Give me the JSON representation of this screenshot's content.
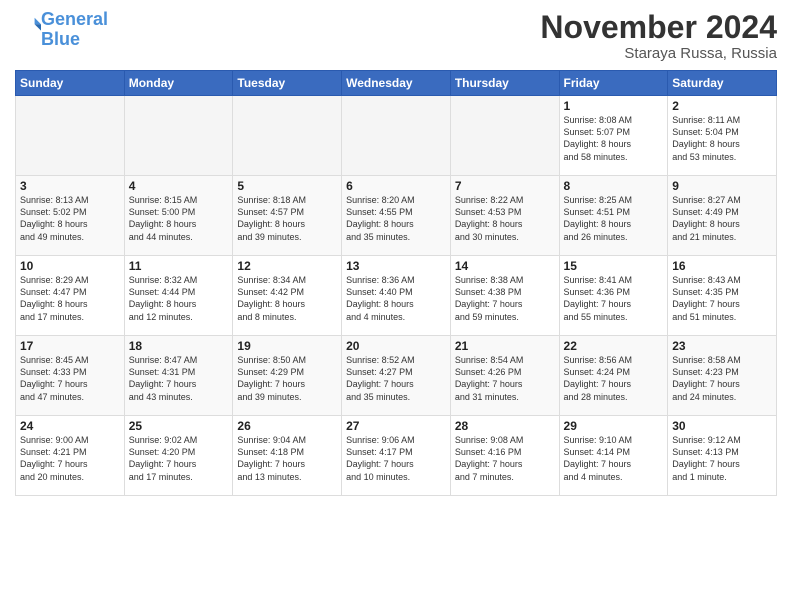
{
  "header": {
    "logo_line1": "General",
    "logo_line2": "Blue",
    "month_title": "November 2024",
    "location": "Staraya Russa, Russia"
  },
  "days_of_week": [
    "Sunday",
    "Monday",
    "Tuesday",
    "Wednesday",
    "Thursday",
    "Friday",
    "Saturday"
  ],
  "weeks": [
    [
      {
        "day": "",
        "info": ""
      },
      {
        "day": "",
        "info": ""
      },
      {
        "day": "",
        "info": ""
      },
      {
        "day": "",
        "info": ""
      },
      {
        "day": "",
        "info": ""
      },
      {
        "day": "1",
        "info": "Sunrise: 8:08 AM\nSunset: 5:07 PM\nDaylight: 8 hours\nand 58 minutes."
      },
      {
        "day": "2",
        "info": "Sunrise: 8:11 AM\nSunset: 5:04 PM\nDaylight: 8 hours\nand 53 minutes."
      }
    ],
    [
      {
        "day": "3",
        "info": "Sunrise: 8:13 AM\nSunset: 5:02 PM\nDaylight: 8 hours\nand 49 minutes."
      },
      {
        "day": "4",
        "info": "Sunrise: 8:15 AM\nSunset: 5:00 PM\nDaylight: 8 hours\nand 44 minutes."
      },
      {
        "day": "5",
        "info": "Sunrise: 8:18 AM\nSunset: 4:57 PM\nDaylight: 8 hours\nand 39 minutes."
      },
      {
        "day": "6",
        "info": "Sunrise: 8:20 AM\nSunset: 4:55 PM\nDaylight: 8 hours\nand 35 minutes."
      },
      {
        "day": "7",
        "info": "Sunrise: 8:22 AM\nSunset: 4:53 PM\nDaylight: 8 hours\nand 30 minutes."
      },
      {
        "day": "8",
        "info": "Sunrise: 8:25 AM\nSunset: 4:51 PM\nDaylight: 8 hours\nand 26 minutes."
      },
      {
        "day": "9",
        "info": "Sunrise: 8:27 AM\nSunset: 4:49 PM\nDaylight: 8 hours\nand 21 minutes."
      }
    ],
    [
      {
        "day": "10",
        "info": "Sunrise: 8:29 AM\nSunset: 4:47 PM\nDaylight: 8 hours\nand 17 minutes."
      },
      {
        "day": "11",
        "info": "Sunrise: 8:32 AM\nSunset: 4:44 PM\nDaylight: 8 hours\nand 12 minutes."
      },
      {
        "day": "12",
        "info": "Sunrise: 8:34 AM\nSunset: 4:42 PM\nDaylight: 8 hours\nand 8 minutes."
      },
      {
        "day": "13",
        "info": "Sunrise: 8:36 AM\nSunset: 4:40 PM\nDaylight: 8 hours\nand 4 minutes."
      },
      {
        "day": "14",
        "info": "Sunrise: 8:38 AM\nSunset: 4:38 PM\nDaylight: 7 hours\nand 59 minutes."
      },
      {
        "day": "15",
        "info": "Sunrise: 8:41 AM\nSunset: 4:36 PM\nDaylight: 7 hours\nand 55 minutes."
      },
      {
        "day": "16",
        "info": "Sunrise: 8:43 AM\nSunset: 4:35 PM\nDaylight: 7 hours\nand 51 minutes."
      }
    ],
    [
      {
        "day": "17",
        "info": "Sunrise: 8:45 AM\nSunset: 4:33 PM\nDaylight: 7 hours\nand 47 minutes."
      },
      {
        "day": "18",
        "info": "Sunrise: 8:47 AM\nSunset: 4:31 PM\nDaylight: 7 hours\nand 43 minutes."
      },
      {
        "day": "19",
        "info": "Sunrise: 8:50 AM\nSunset: 4:29 PM\nDaylight: 7 hours\nand 39 minutes."
      },
      {
        "day": "20",
        "info": "Sunrise: 8:52 AM\nSunset: 4:27 PM\nDaylight: 7 hours\nand 35 minutes."
      },
      {
        "day": "21",
        "info": "Sunrise: 8:54 AM\nSunset: 4:26 PM\nDaylight: 7 hours\nand 31 minutes."
      },
      {
        "day": "22",
        "info": "Sunrise: 8:56 AM\nSunset: 4:24 PM\nDaylight: 7 hours\nand 28 minutes."
      },
      {
        "day": "23",
        "info": "Sunrise: 8:58 AM\nSunset: 4:23 PM\nDaylight: 7 hours\nand 24 minutes."
      }
    ],
    [
      {
        "day": "24",
        "info": "Sunrise: 9:00 AM\nSunset: 4:21 PM\nDaylight: 7 hours\nand 20 minutes."
      },
      {
        "day": "25",
        "info": "Sunrise: 9:02 AM\nSunset: 4:20 PM\nDaylight: 7 hours\nand 17 minutes."
      },
      {
        "day": "26",
        "info": "Sunrise: 9:04 AM\nSunset: 4:18 PM\nDaylight: 7 hours\nand 13 minutes."
      },
      {
        "day": "27",
        "info": "Sunrise: 9:06 AM\nSunset: 4:17 PM\nDaylight: 7 hours\nand 10 minutes."
      },
      {
        "day": "28",
        "info": "Sunrise: 9:08 AM\nSunset: 4:16 PM\nDaylight: 7 hours\nand 7 minutes."
      },
      {
        "day": "29",
        "info": "Sunrise: 9:10 AM\nSunset: 4:14 PM\nDaylight: 7 hours\nand 4 minutes."
      },
      {
        "day": "30",
        "info": "Sunrise: 9:12 AM\nSunset: 4:13 PM\nDaylight: 7 hours\nand 1 minute."
      }
    ]
  ]
}
